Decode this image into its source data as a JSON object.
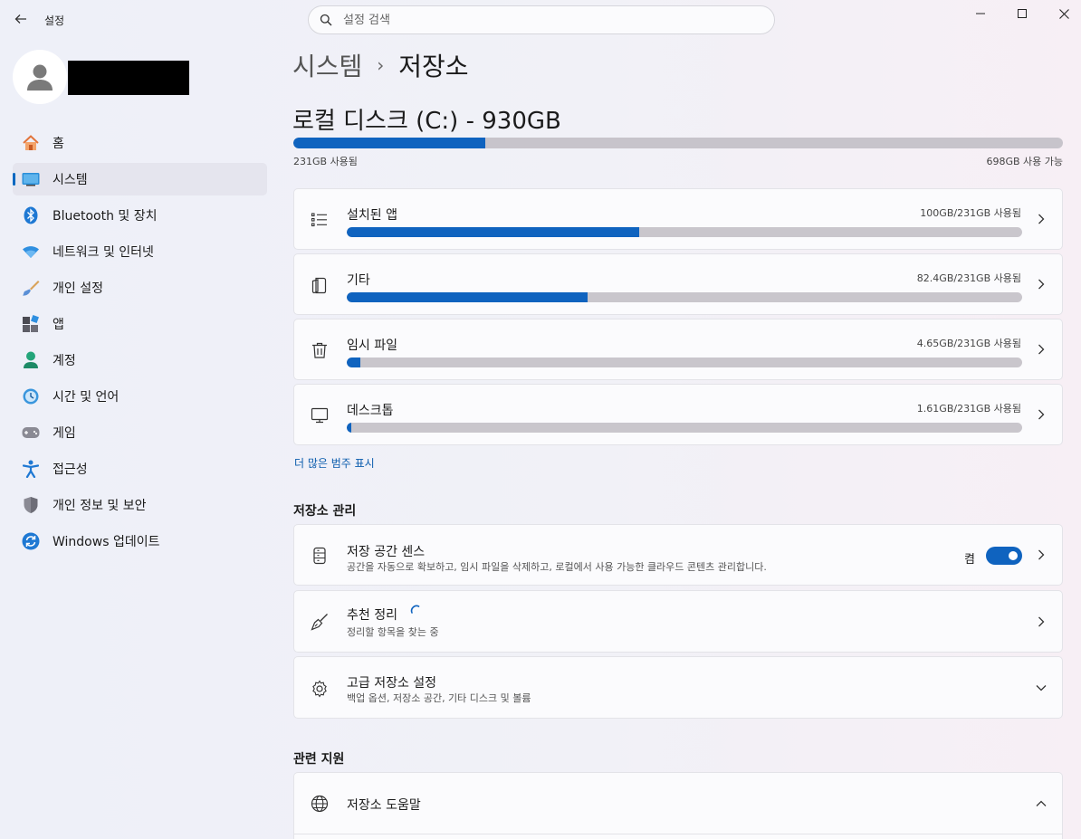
{
  "window": {
    "title": "설정",
    "controls": [
      "minimize-icon",
      "maximize-icon",
      "close-icon"
    ]
  },
  "search": {
    "placeholder": "설정 검색"
  },
  "sidebar": {
    "items": [
      {
        "label": "홈",
        "icon": "home-icon"
      },
      {
        "label": "시스템",
        "icon": "system-icon",
        "active": true
      },
      {
        "label": "Bluetooth 및 장치",
        "icon": "bluetooth-icon"
      },
      {
        "label": "네트워크 및 인터넷",
        "icon": "wifi-icon"
      },
      {
        "label": "개인 설정",
        "icon": "paintbrush-icon"
      },
      {
        "label": "앱",
        "icon": "apps-icon"
      },
      {
        "label": "계정",
        "icon": "account-icon"
      },
      {
        "label": "시간 및 언어",
        "icon": "time-language-icon"
      },
      {
        "label": "게임",
        "icon": "gamepad-icon"
      },
      {
        "label": "접근성",
        "icon": "accessibility-icon"
      },
      {
        "label": "개인 정보 및 보안",
        "icon": "shield-icon"
      },
      {
        "label": "Windows 업데이트",
        "icon": "update-icon"
      }
    ]
  },
  "breadcrumb": {
    "parent": "시스템",
    "separator": "›",
    "current": "저장소"
  },
  "disk": {
    "title": "로컬 디스크 (C:) - 930GB",
    "used_fraction": 0.249,
    "used_label": "231GB 사용됨",
    "free_label": "698GB 사용 가능"
  },
  "categories": [
    {
      "label": "설치된 앱",
      "size": "100GB/231GB 사용됨",
      "fraction": 0.433,
      "icon": "list-icon"
    },
    {
      "label": "기타",
      "size": "82.4GB/231GB 사용됨",
      "fraction": 0.357,
      "icon": "document-icon"
    },
    {
      "label": "임시 파일",
      "size": "4.65GB/231GB 사용됨",
      "fraction": 0.02,
      "icon": "trash-icon"
    },
    {
      "label": "데스크톱",
      "size": "1.61GB/231GB 사용됨",
      "fraction": 0.007,
      "icon": "monitor-icon"
    }
  ],
  "more_link": "더 많은 범주 표시",
  "management": {
    "title": "저장소 관리",
    "storage_sense": {
      "title": "저장 공간 센스",
      "subtitle": "공간을 자동으로 확보하고, 임시 파일을 삭제하고, 로컬에서 사용 가능한 클라우드 콘텐츠 관리합니다.",
      "toggle_label": "켬",
      "toggle_on": true
    },
    "cleanup": {
      "title": "추천 정리",
      "subtitle": "정리할 항목을 찾는 중"
    },
    "advanced": {
      "title": "고급 저장소 설정",
      "subtitle": "백업 옵션, 저장소 공간, 기타 디스크 및 볼륨"
    }
  },
  "support": {
    "title": "관련 지원",
    "help": {
      "title": "저장소 도움말"
    }
  },
  "colors": {
    "accent": "#0f63bf",
    "bar_track": "#c7c4cb"
  }
}
